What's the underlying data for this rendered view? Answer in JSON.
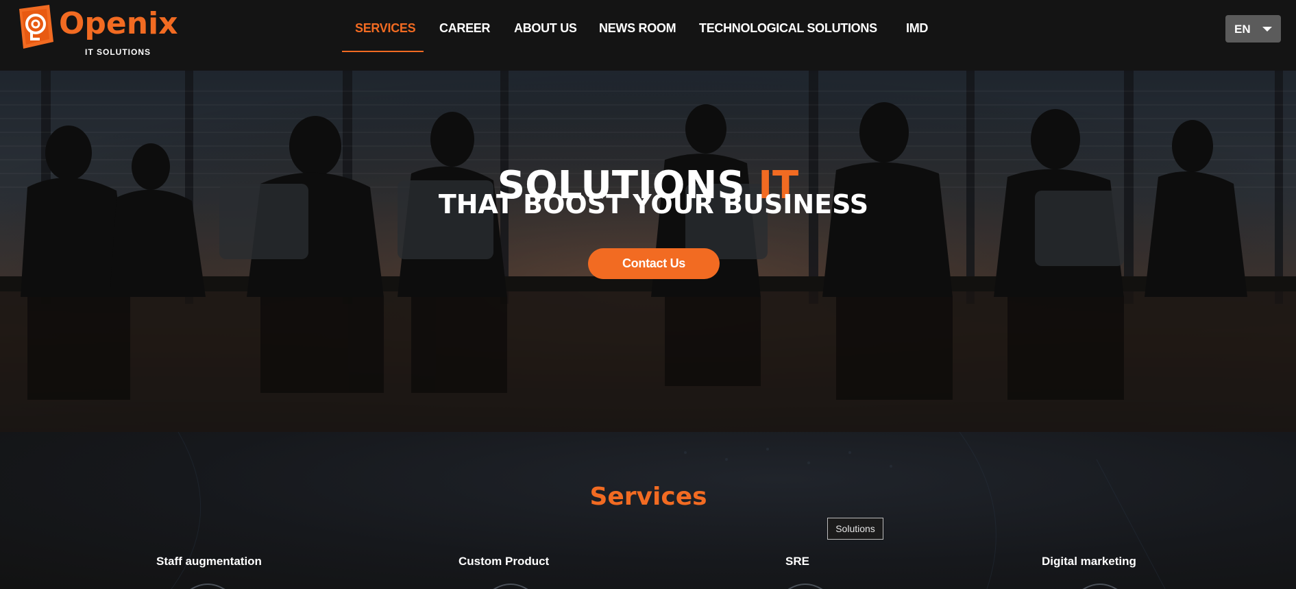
{
  "brand": {
    "name": "Openix",
    "tagline": "IT SOLUTIONS",
    "accent_color": "#f26b22"
  },
  "nav": {
    "items": [
      {
        "label": "SERVICES",
        "active": true
      },
      {
        "label": "CAREER",
        "active": false
      },
      {
        "label": "ABOUT US",
        "active": false
      },
      {
        "label": "NEWS ROOM",
        "active": false
      },
      {
        "label": "TECHNOLOGICAL SOLUTIONS",
        "active": false
      },
      {
        "label": "IMD",
        "active": false
      }
    ]
  },
  "language": {
    "selected": "EN",
    "icon": "chevron-down-icon"
  },
  "hero": {
    "title_main": "SOLUTIONS ",
    "title_accent": "IT",
    "subtitle": "THAT BOOST YOUR BUSINESS",
    "cta_label": "Contact Us"
  },
  "services": {
    "heading": "Services",
    "tooltip": "Solutions",
    "items": [
      {
        "label": "Staff augmentation"
      },
      {
        "label": "Custom Product"
      },
      {
        "label": "SRE"
      },
      {
        "label": "Digital marketing"
      }
    ]
  }
}
